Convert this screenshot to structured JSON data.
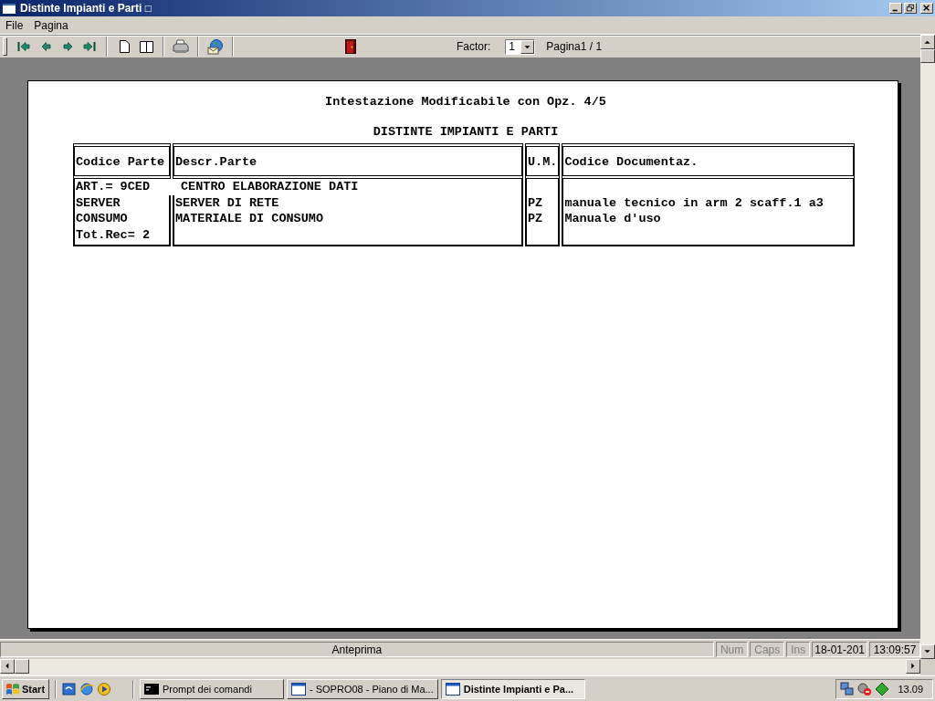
{
  "window": {
    "title": "Distinte Impianti e Parti □"
  },
  "menu": [
    "File",
    "Pagina"
  ],
  "toolbar": {
    "factor_label": "Factor:",
    "factor_value": "1",
    "page_label": "Pagina1 / 1"
  },
  "report": {
    "header": "Intestazione Modificabile con Opz. 4/5",
    "title": "DISTINTE IMPIANTI E PARTI",
    "columns": [
      "Codice Parte",
      "Descr.Parte",
      "U.M.",
      "Codice Documentaz."
    ],
    "group_row": {
      "code": "ART.= 9CED",
      "description": "CENTRO ELABORAZIONE DATI"
    },
    "rows": [
      {
        "cells": [
          "SERVER",
          "SERVER DI RETE",
          "PZ",
          "manuale tecnico in arm 2 scaff.1 a3"
        ]
      },
      {
        "cells": [
          "CONSUMO",
          "MATERIALE DI CONSUMO",
          "PZ",
          "Manuale d'uso"
        ]
      }
    ],
    "total": "Tot.Rec= 2"
  },
  "status_bar": {
    "message": "Anteprima",
    "indicators": [
      {
        "label": "Num",
        "on": false
      },
      {
        "label": "Caps",
        "on": false
      },
      {
        "label": "Ins",
        "on": false
      }
    ],
    "date": "18-01-201",
    "time": "13:09:57"
  },
  "taskbar": {
    "start": "Start",
    "tasks": [
      {
        "kind": "console",
        "label": "Prompt dei comandi",
        "selected": false
      },
      {
        "kind": "window",
        "label": "- SOPRO08 - Piano di Ma...",
        "selected": false
      },
      {
        "kind": "window",
        "label": "Distinte Impianti e Pa...",
        "selected": true
      }
    ],
    "clock": "13.09"
  }
}
